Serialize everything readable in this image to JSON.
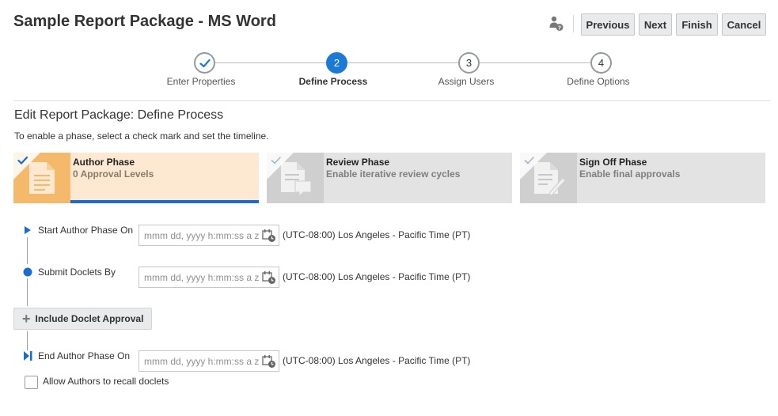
{
  "header": {
    "title": "Sample Report Package - MS Word",
    "buttons": {
      "previous": "Previous",
      "next": "Next",
      "finish": "Finish",
      "cancel": "Cancel"
    }
  },
  "wizard": {
    "steps": [
      {
        "number": "1",
        "label": "Enter Properties",
        "state": "done"
      },
      {
        "number": "2",
        "label": "Define Process",
        "state": "active"
      },
      {
        "number": "3",
        "label": "Assign Users",
        "state": "pending"
      },
      {
        "number": "4",
        "label": "Define Options",
        "state": "pending"
      }
    ]
  },
  "page": {
    "subtitle": "Edit Report Package: Define Process",
    "instruction": "To enable a phase, select a check mark and set the timeline."
  },
  "phases": [
    {
      "name": "Author Phase",
      "description": "0 Approval Levels",
      "selected": true
    },
    {
      "name": "Review Phase",
      "description": "Enable iterative review cycles",
      "selected": false
    },
    {
      "name": "Sign Off Phase",
      "description": "Enable final approvals",
      "selected": false
    }
  ],
  "timeline": {
    "start": {
      "label": "Start Author Phase On",
      "placeholder": "mmm dd, yyyy h:mm:ss a z",
      "timezone": "(UTC-08:00) Los Angeles - Pacific Time (PT)"
    },
    "submit": {
      "label": "Submit Doclets By",
      "placeholder": "mmm dd, yyyy h:mm:ss a z",
      "timezone": "(UTC-08:00) Los Angeles - Pacific Time (PT)"
    },
    "include_button": "Include Doclet Approval",
    "end": {
      "label": "End Author Phase On",
      "placeholder": "mmm dd, yyyy h:mm:ss a z",
      "timezone": "(UTC-08:00) Los Angeles - Pacific Time (PT)"
    },
    "allow_recall_label": "Allow Authors to recall doclets"
  },
  "colors": {
    "accent": "#1c7ad6",
    "author_card_bg": "#fde8d2",
    "author_icon_bg": "#f4b96a",
    "inactive_card_bg": "#e3e3e3"
  },
  "icons": [
    "user-help-icon",
    "check-icon",
    "document-icon",
    "chat-document-icon",
    "sign-document-icon",
    "calendar-clock-icon",
    "plus-icon"
  ]
}
